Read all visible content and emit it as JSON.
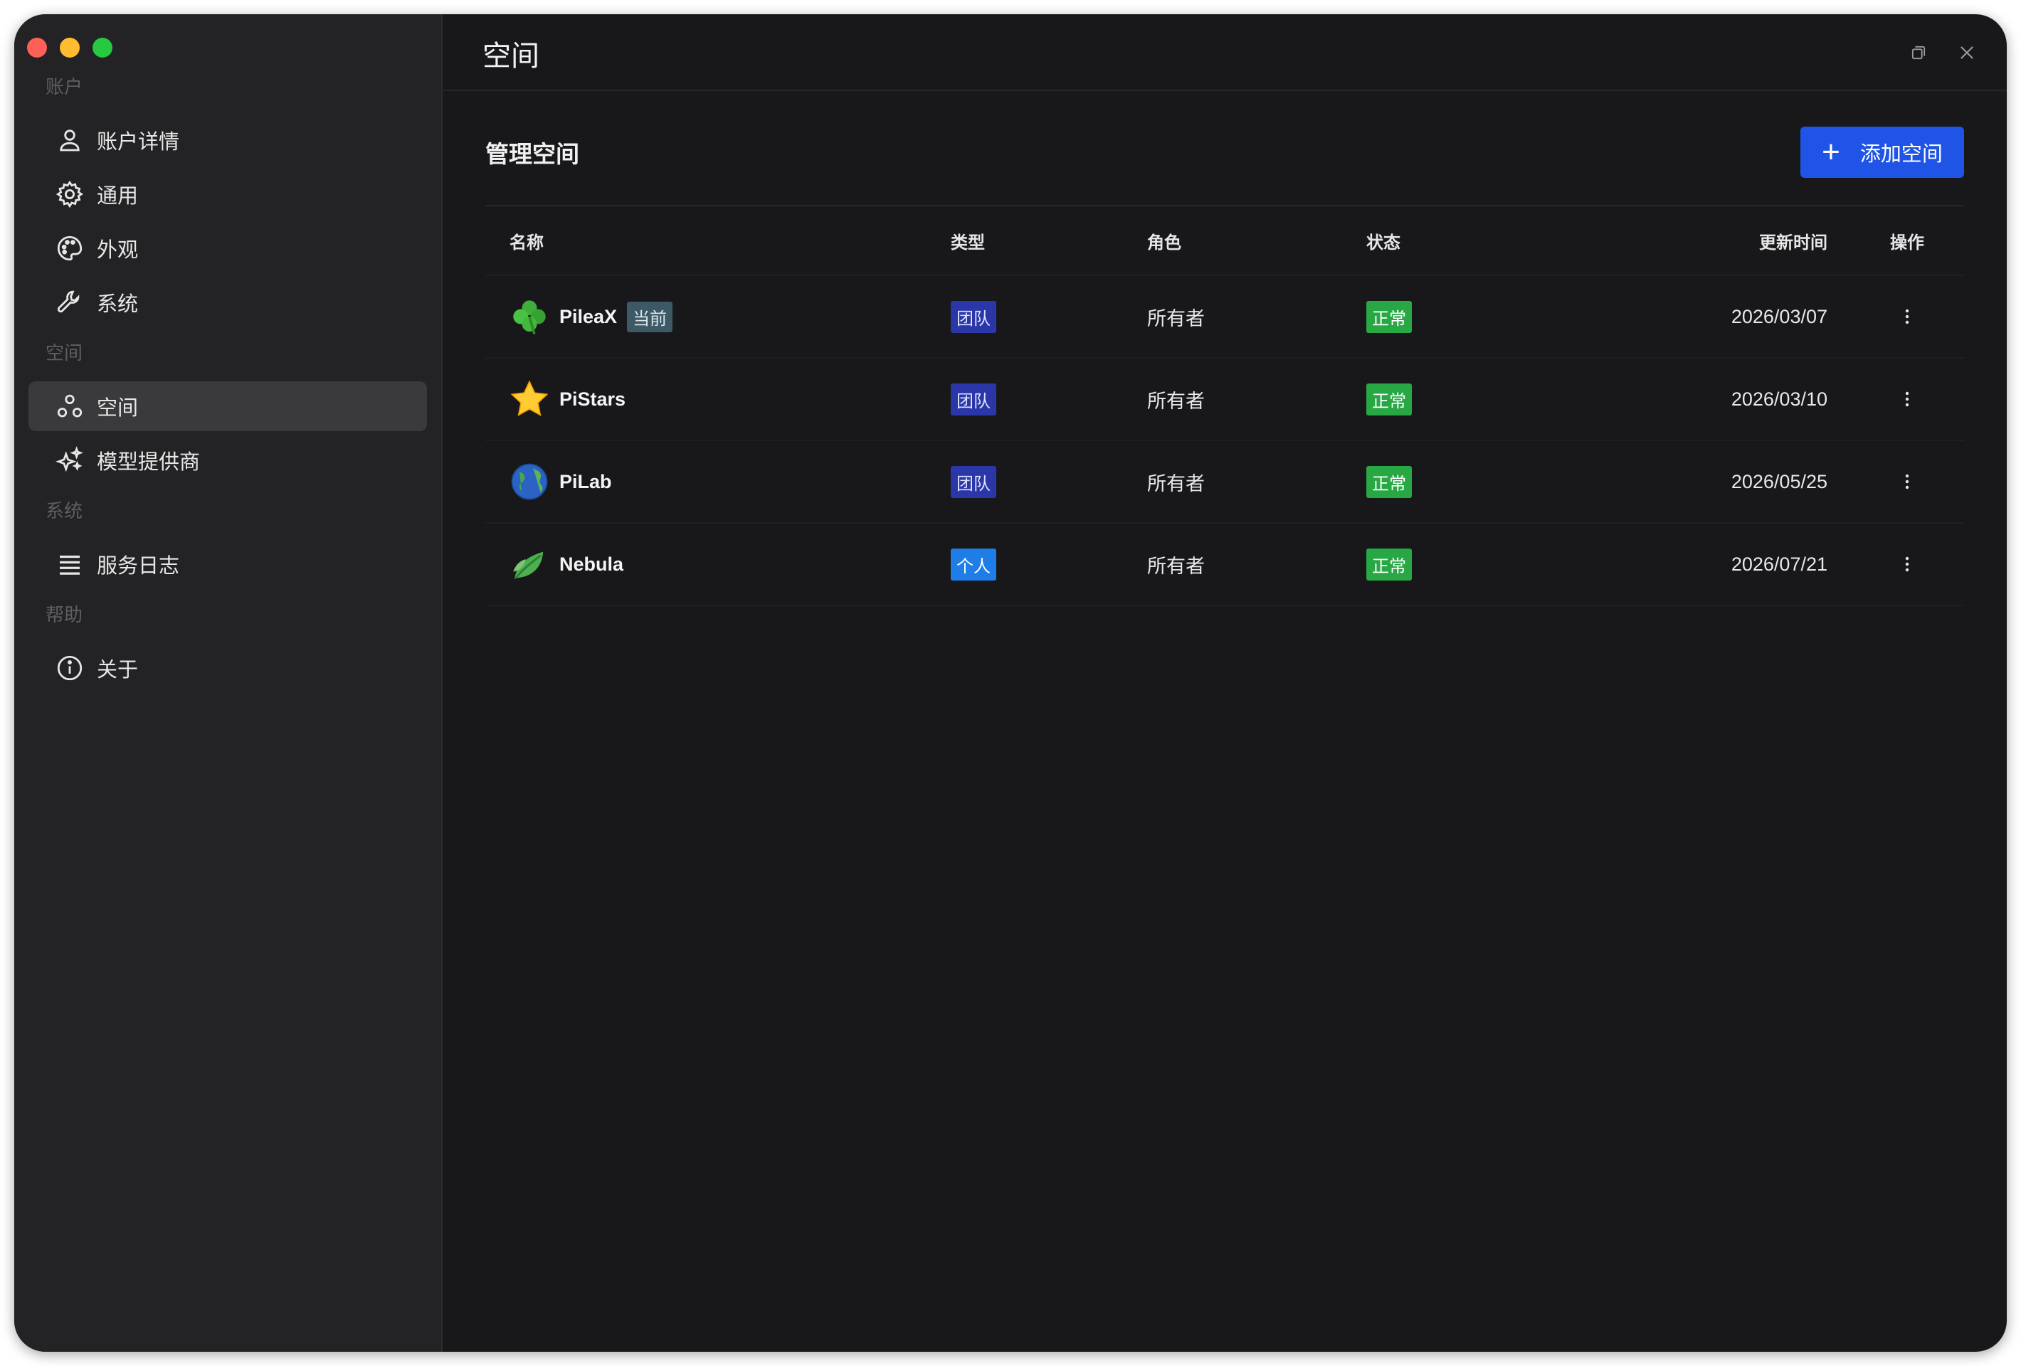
{
  "window": {
    "title": "空间"
  },
  "sidebar": {
    "sections": [
      {
        "label": "账户",
        "items": [
          {
            "label": "账户详情",
            "icon": "user-icon"
          },
          {
            "label": "通用",
            "icon": "gear-icon"
          },
          {
            "label": "外观",
            "icon": "palette-icon"
          },
          {
            "label": "系统",
            "icon": "wrench-icon"
          }
        ]
      },
      {
        "label": "空间",
        "items": [
          {
            "label": "空间",
            "icon": "spaces-icon",
            "active": true
          },
          {
            "label": "模型提供商",
            "icon": "sparkles-icon"
          }
        ]
      },
      {
        "label": "系统",
        "items": [
          {
            "label": "服务日志",
            "icon": "list-icon"
          }
        ]
      },
      {
        "label": "帮助",
        "items": [
          {
            "label": "关于",
            "icon": "info-icon"
          }
        ]
      }
    ]
  },
  "main": {
    "section_title": "管理空间",
    "add_button_label": "添加空间",
    "table": {
      "headers": {
        "name": "名称",
        "type": "类型",
        "role": "角色",
        "status": "状态",
        "updated": "更新时间",
        "action": "操作"
      },
      "rows": [
        {
          "name": "PileaX",
          "icon": "clover-icon",
          "current_tag": "当前",
          "type": "团队",
          "role": "所有者",
          "status": "正常",
          "updated": "2026/03/07"
        },
        {
          "name": "PiStars",
          "icon": "star-icon",
          "current_tag": "",
          "type": "团队",
          "role": "所有者",
          "status": "正常",
          "updated": "2026/03/10"
        },
        {
          "name": "PiLab",
          "icon": "globe-icon",
          "current_tag": "",
          "type": "团队",
          "role": "所有者",
          "status": "正常",
          "updated": "2026/05/25"
        },
        {
          "name": "Nebula",
          "icon": "leaf-icon",
          "current_tag": "",
          "type": "个人",
          "role": "所有者",
          "status": "正常",
          "updated": "2026/07/21"
        }
      ]
    }
  },
  "colors": {
    "accent": "#1f54e6",
    "team_badge": "#2b37a8",
    "personal_badge": "#1e7de6",
    "status_ok": "#28a745",
    "current_tag": "#3e5966"
  }
}
